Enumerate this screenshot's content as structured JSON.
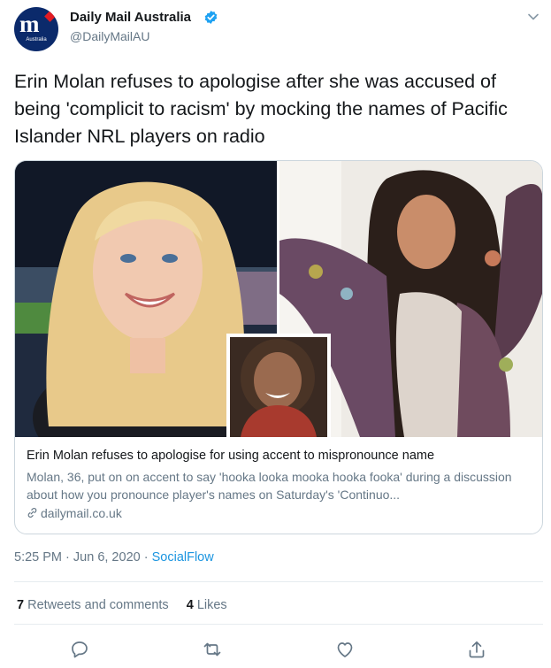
{
  "account": {
    "display_name": "Daily Mail Australia",
    "handle": "@DailyMailAU",
    "avatar_logo": "m",
    "avatar_sub": "Australia",
    "verified": true
  },
  "tweet": {
    "text": "Erin Molan refuses to apologise after she was accused of being 'complicit to racism' by mocking the names of Pacific Islander NRL players on radio"
  },
  "card": {
    "title": "Erin Molan refuses to apologise for using accent to mispronounce name",
    "description": "Molan, 36, put on on accent to say 'hooka looka mooka hooka fooka' during a discussion about how you pronounce player's names on Saturday's 'Continuo...",
    "domain": "dailymail.co.uk"
  },
  "meta": {
    "time": "5:25 PM",
    "separator": "·",
    "date": "Jun 6, 2020",
    "source": "SocialFlow"
  },
  "stats": {
    "retweets_count": "7",
    "retweets_label": "Retweets and comments",
    "likes_count": "4",
    "likes_label": "Likes"
  },
  "actions": [
    "reply-icon",
    "retweet-icon",
    "like-icon",
    "share-icon"
  ],
  "colors": {
    "accent": "#1b95e0",
    "verified": "#1da1f2",
    "text_primary": "#14171a",
    "text_secondary": "#657786",
    "border": "#ccd6dd"
  }
}
